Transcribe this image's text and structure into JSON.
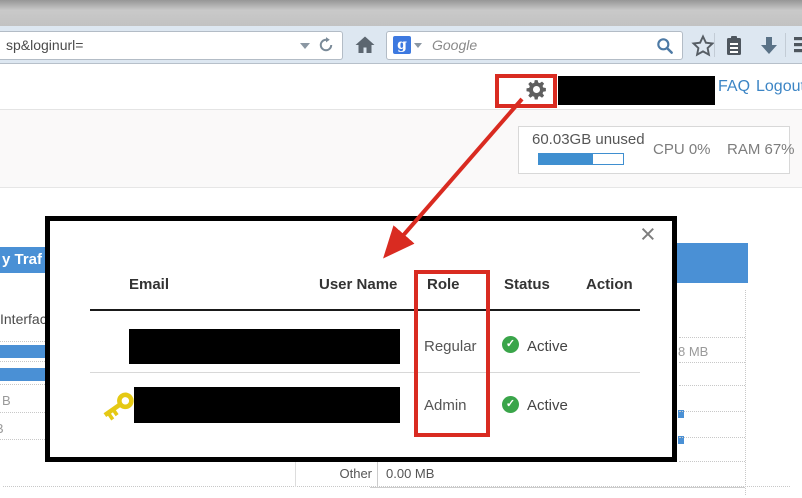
{
  "browser": {
    "url_bar": {
      "value": "sp&loginurl="
    },
    "search_bar": {
      "placeholder": "Google",
      "favicon_glyph": "g"
    }
  },
  "app_header": {
    "faq_label": "FAQ",
    "logout_label": "Logout"
  },
  "system_stats": {
    "disk_unused": "60.03GB unused",
    "cpu": "CPU 0%",
    "ram": "RAM 67%",
    "disk_bar_percent": 64
  },
  "user_modal": {
    "close_glyph": "×",
    "columns": [
      "Email",
      "User Name",
      "Role",
      "Status",
      "Action"
    ],
    "rows": [
      {
        "email_redacted": true,
        "role": "Regular",
        "status": "Active"
      },
      {
        "email_redacted": true,
        "role": "Admin",
        "status": "Active",
        "has_key_icon": true
      }
    ]
  },
  "background_page": {
    "panel_title_fragment": "y Traf",
    "interface_label_fragment": "Interfac",
    "unit_fragment_row1": "B",
    "unit_fragment_row2": "B",
    "value_right": "8 MB",
    "other_label": "Other",
    "other_value": "0.00 MB"
  },
  "icons": {
    "gear": "svg-gear",
    "home": "svg-house",
    "star": "svg-star-outline",
    "clipboard": "svg-clipboard",
    "download_arrow": "svg-down-arrow",
    "magnifier": "svg-magnifier",
    "reload": "svg-circular-arrow",
    "menu": "svg-hamburger",
    "key": "svg-key",
    "active_check": "✓",
    "caret_down": "css-triangle"
  },
  "colors": {
    "annotation_red": "#d92b21",
    "panel_blue": "#4a90d5",
    "link_blue": "#3c85c5",
    "progress_blue": "#3f8fd0",
    "active_green": "#3aa54a",
    "key_yellow": "#e5c914"
  }
}
